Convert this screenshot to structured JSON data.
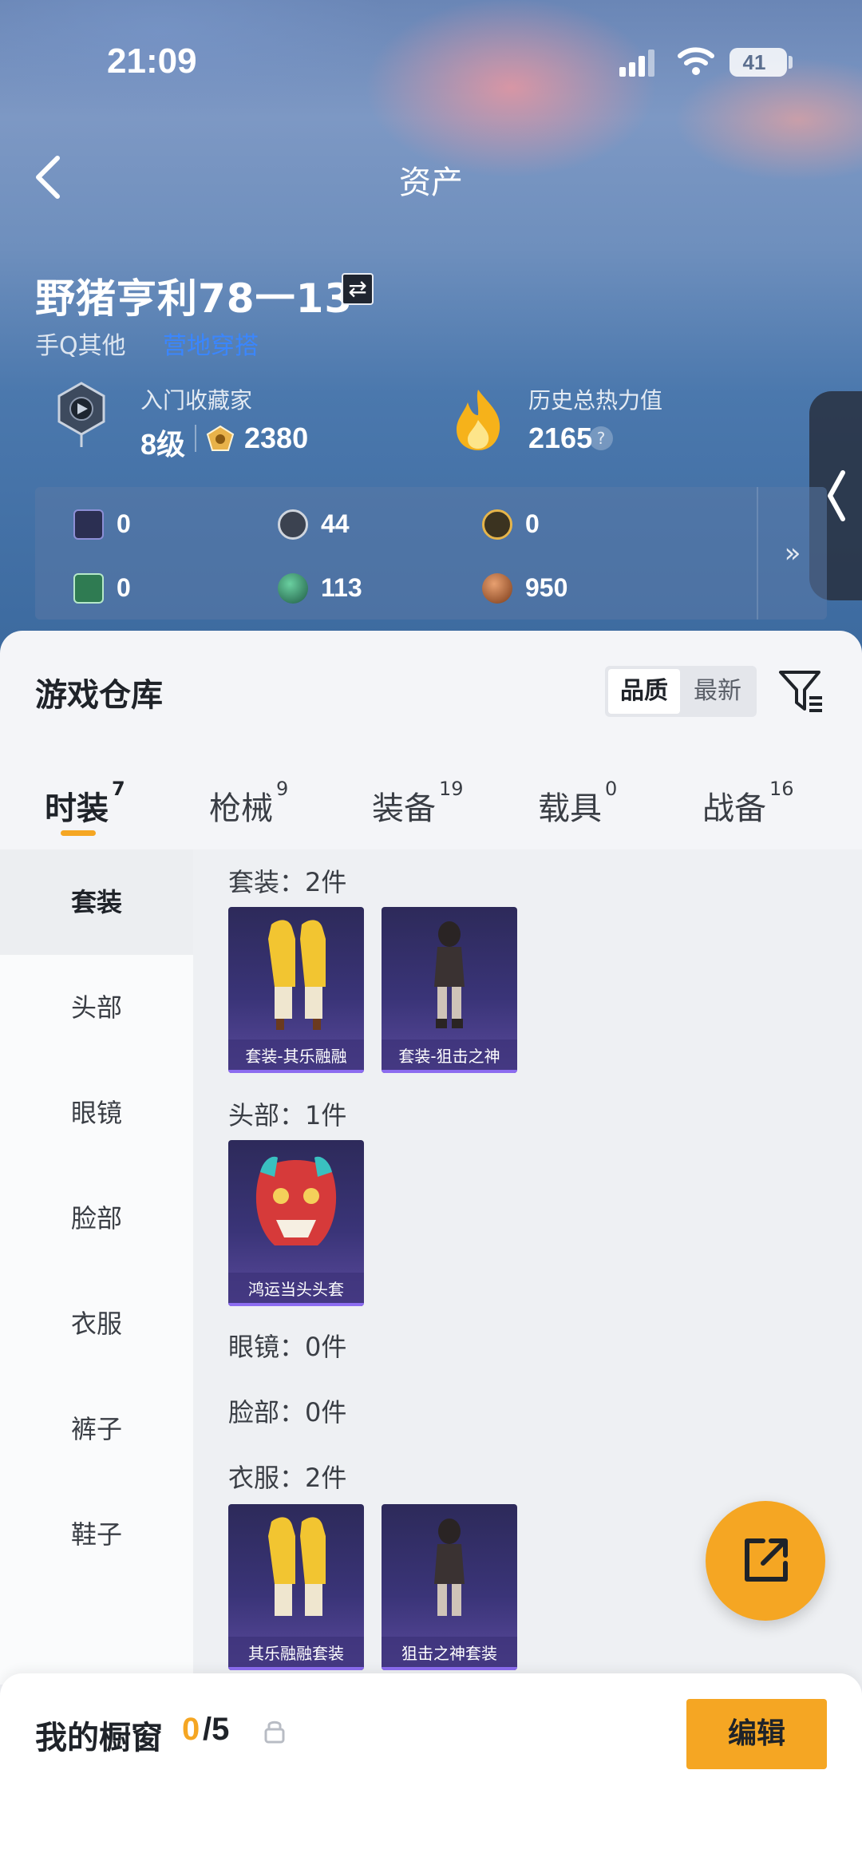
{
  "status_bar": {
    "time": "21:09",
    "battery": "41"
  },
  "nav": {
    "title": "资产"
  },
  "player": {
    "name": "野猪亨利78一13",
    "platform": "手Q其他",
    "platform_link": "营地穿搭"
  },
  "collector": {
    "title": "入门收藏家",
    "level": "8级",
    "points": "2380"
  },
  "heat": {
    "title": "历史总热力值",
    "value": "2165",
    "help": "?"
  },
  "currencies": [
    {
      "icon": "purple-card-icon",
      "value": "0"
    },
    {
      "icon": "silver-coin-icon",
      "value": "44"
    },
    {
      "icon": "gold-coin-icon",
      "value": "0"
    },
    {
      "icon": "green-card-icon",
      "value": "0"
    },
    {
      "icon": "green-gem-icon",
      "value": "113"
    },
    {
      "icon": "bronze-coin-icon",
      "value": "950"
    }
  ],
  "currency_more": "»",
  "warehouse": {
    "title": "游戏仓库",
    "sort": [
      "品质",
      "最新"
    ],
    "tabs": [
      {
        "label": "时装",
        "count": "7"
      },
      {
        "label": "枪械",
        "count": "9"
      },
      {
        "label": "装备",
        "count": "19"
      },
      {
        "label": "载具",
        "count": "0"
      },
      {
        "label": "战备",
        "count": "16"
      }
    ],
    "sidebar": [
      "套装",
      "头部",
      "眼镜",
      "脸部",
      "衣服",
      "裤子",
      "鞋子"
    ],
    "sections": [
      {
        "title": "套装：2件",
        "items": [
          "套装-其乐融融",
          "套装-狙击之神"
        ]
      },
      {
        "title": "头部：1件",
        "items": [
          "鸿运当头头套"
        ]
      },
      {
        "title": "眼镜：0件",
        "items": []
      },
      {
        "title": "脸部：0件",
        "items": []
      },
      {
        "title": "衣服：2件",
        "items": [
          "其乐融融套装",
          "狙击之神套装"
        ]
      }
    ]
  },
  "showcase": {
    "title": "我的橱窗",
    "count": "0",
    "max": "/5",
    "edit": "编辑"
  },
  "colors": {
    "accent": "#f5a623",
    "link": "#3a86ff",
    "card_purple": "#3a3478"
  }
}
